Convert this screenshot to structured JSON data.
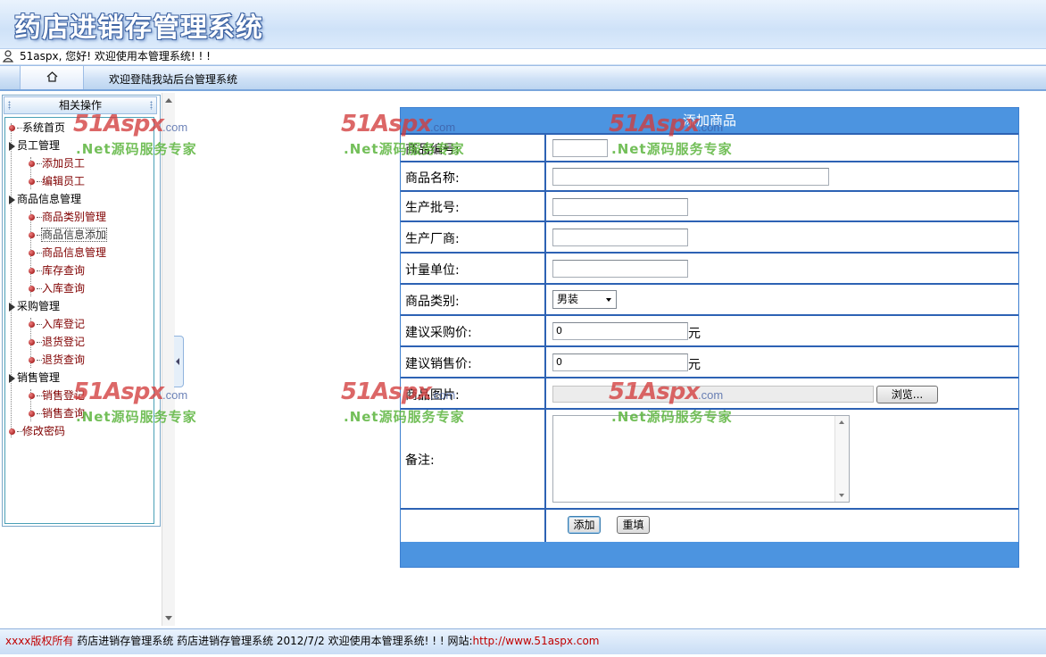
{
  "header": {
    "title": "药店进销存管理系统"
  },
  "userbar": {
    "greeting": "51aspx, 您好! 欢迎使用本管理系统! ! !"
  },
  "navbar": {
    "welcome": "欢迎登陆我站后台管理系统"
  },
  "sidebar": {
    "title": "相关操作",
    "items": [
      {
        "label": "系统首页",
        "type": "root-leaf"
      },
      {
        "label": "员工管理",
        "type": "group"
      },
      {
        "label": "添加员工",
        "type": "leaf"
      },
      {
        "label": "编辑员工",
        "type": "leaf"
      },
      {
        "label": "商品信息管理",
        "type": "group"
      },
      {
        "label": "商品类别管理",
        "type": "leaf"
      },
      {
        "label": "商品信息添加",
        "type": "leaf"
      },
      {
        "label": "商品信息管理",
        "type": "leaf"
      },
      {
        "label": "库存查询",
        "type": "leaf"
      },
      {
        "label": "入库查询",
        "type": "leaf"
      },
      {
        "label": "采购管理",
        "type": "group"
      },
      {
        "label": "入库登记",
        "type": "leaf"
      },
      {
        "label": "退货登记",
        "type": "leaf"
      },
      {
        "label": "退货查询",
        "type": "leaf"
      },
      {
        "label": "销售管理",
        "type": "group"
      },
      {
        "label": "销售登记",
        "type": "leaf"
      },
      {
        "label": "销售查询",
        "type": "leaf"
      },
      {
        "label": "修改密码",
        "type": "root-leaf"
      }
    ]
  },
  "form": {
    "title": "添加商品",
    "fields": {
      "code": {
        "label": "商品编号:",
        "value": ""
      },
      "name": {
        "label": "商品名称:",
        "value": ""
      },
      "batch": {
        "label": "生产批号:",
        "value": ""
      },
      "maker": {
        "label": "生产厂商:",
        "value": ""
      },
      "unit": {
        "label": "计量单位:",
        "value": ""
      },
      "category": {
        "label": "商品类别:",
        "selected": "男装"
      },
      "buy_price": {
        "label": "建议采购价:",
        "value": "0",
        "unit": "元"
      },
      "sell_price": {
        "label": "建议销售价:",
        "value": "0",
        "unit": "元"
      },
      "image": {
        "label": "商品图片:",
        "browse_label": "浏览..."
      },
      "remark": {
        "label": "备注:",
        "value": ""
      }
    },
    "buttons": {
      "add": "添加",
      "reset": "重填"
    }
  },
  "footer": {
    "copyright": "xxxx版权所有",
    "text": "药店进销存管理系统   药店进销存管理系统  2012/7/2 欢迎使用本管理系统! ! !   网站:",
    "link": "http://www.51aspx.com"
  },
  "watermark": {
    "logo": "51Aspx",
    "com": ".com",
    "sub": ".Net源码服务专家"
  },
  "colors": {
    "form_header": "#4c94e0",
    "form_border": "#2d62b4",
    "leaf_text": "#800000"
  }
}
